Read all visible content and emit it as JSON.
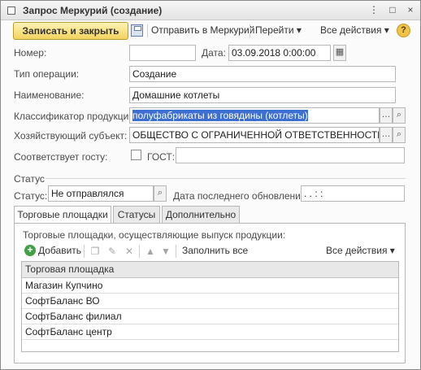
{
  "window": {
    "title": "Запрос Меркурий (создание)",
    "controls": [
      "⋮",
      "□",
      "×"
    ]
  },
  "toolbar": {
    "save_close_label": "Записать и закрыть",
    "send_mercury_label": "Отправить в Меркурий",
    "goto_label": "Перейти ▾",
    "all_actions_label": "Все действия ▾",
    "help_label": "?"
  },
  "form": {
    "number_label": "Номер:",
    "number_value": "",
    "date_label": "Дата:",
    "date_value": "03.09.2018  0:00:00",
    "operation_type_label": "Тип операции:",
    "operation_type_value": "Создание",
    "name_label": "Наименование:",
    "name_value": "Домашние котлеты",
    "classifier_label": "Классификатор продукции:",
    "classifier_value": "полуфабрикаты из говядины (котлеты)",
    "entity_label": "Хозяйствующий субъект:",
    "entity_value": "ОБЩЕСТВО С ОГРАНИЧЕННОЙ ОТВЕТСТВЕННОСТЬЮ \"ГН",
    "gost_match_label": "Соответствует госту:",
    "gost_label": "ГОСТ:",
    "gost_value": ""
  },
  "status_section": {
    "heading": "Статус",
    "status_label": "Статус:",
    "status_value": "Не отправлялся",
    "last_update_label": "Дата последнего обновления:",
    "last_update_value": " .  .      :  :"
  },
  "tabs": [
    "Торговые площадки",
    "Статусы",
    "Дополнительно"
  ],
  "trade_tab": {
    "description": "Торговые площадки, осуществляющие выпуск продукции:",
    "add_label": "Добавить",
    "fill_all_label": "Заполнить все",
    "all_actions_label": "Все действия ▾",
    "column_header": "Торговая площадка",
    "rows": [
      "Магазин Купчино",
      "СофтБаланс ВО",
      "СофтБаланс филиал",
      "СофтБаланс центр"
    ]
  }
}
